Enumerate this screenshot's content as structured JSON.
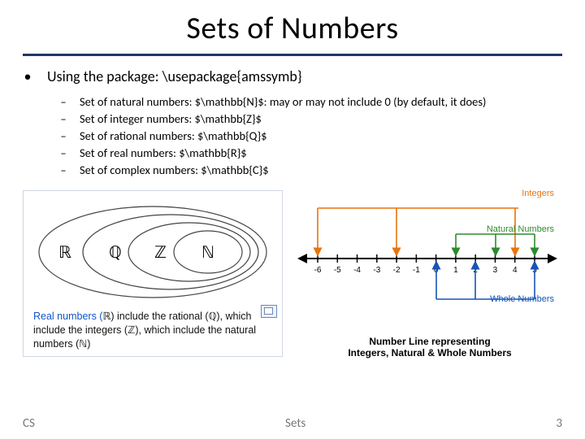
{
  "title": "Sets of Numbers",
  "points": {
    "l1": "Using the package: \\usepackage{amssymb}",
    "subs": [
      "Set of natural numbers: $\\mathbb{N}$:  may or may not include 0 (by default, it does)",
      "Set of integer numbers: $\\mathbb{Z}$",
      "Set of rational numbers: $\\mathbb{Q}$",
      "Set of real numbers: $\\mathbb{R}$",
      "Set of complex numbers: $\\mathbb{C}$"
    ]
  },
  "venn": {
    "labels": {
      "R": "ℝ",
      "Q": "ℚ",
      "Z": "ℤ",
      "N": "ℕ"
    },
    "caption_parts": {
      "a": "Real numbers (",
      "r": "ℝ",
      "b": ") include the rational (",
      "q": "ℚ",
      "c": "), which include the integers (",
      "z": "ℤ",
      "d": "), which include the natural numbers (",
      "n": "ℕ",
      "e": ")"
    }
  },
  "numberline": {
    "ticks": [
      "-6",
      "-5",
      "-4",
      "-3",
      "-2",
      "-1",
      "0",
      "1",
      "2",
      "3",
      "4",
      "5"
    ],
    "label_integers": "Integers",
    "label_natural": "Natural Numbers",
    "label_whole": "Whole Numbers",
    "caption_l1": "Number Line representing",
    "caption_l2": "Integers, Natural & Whole Numbers"
  },
  "footer": {
    "left": "CS",
    "center": "Sets",
    "right": "3"
  }
}
